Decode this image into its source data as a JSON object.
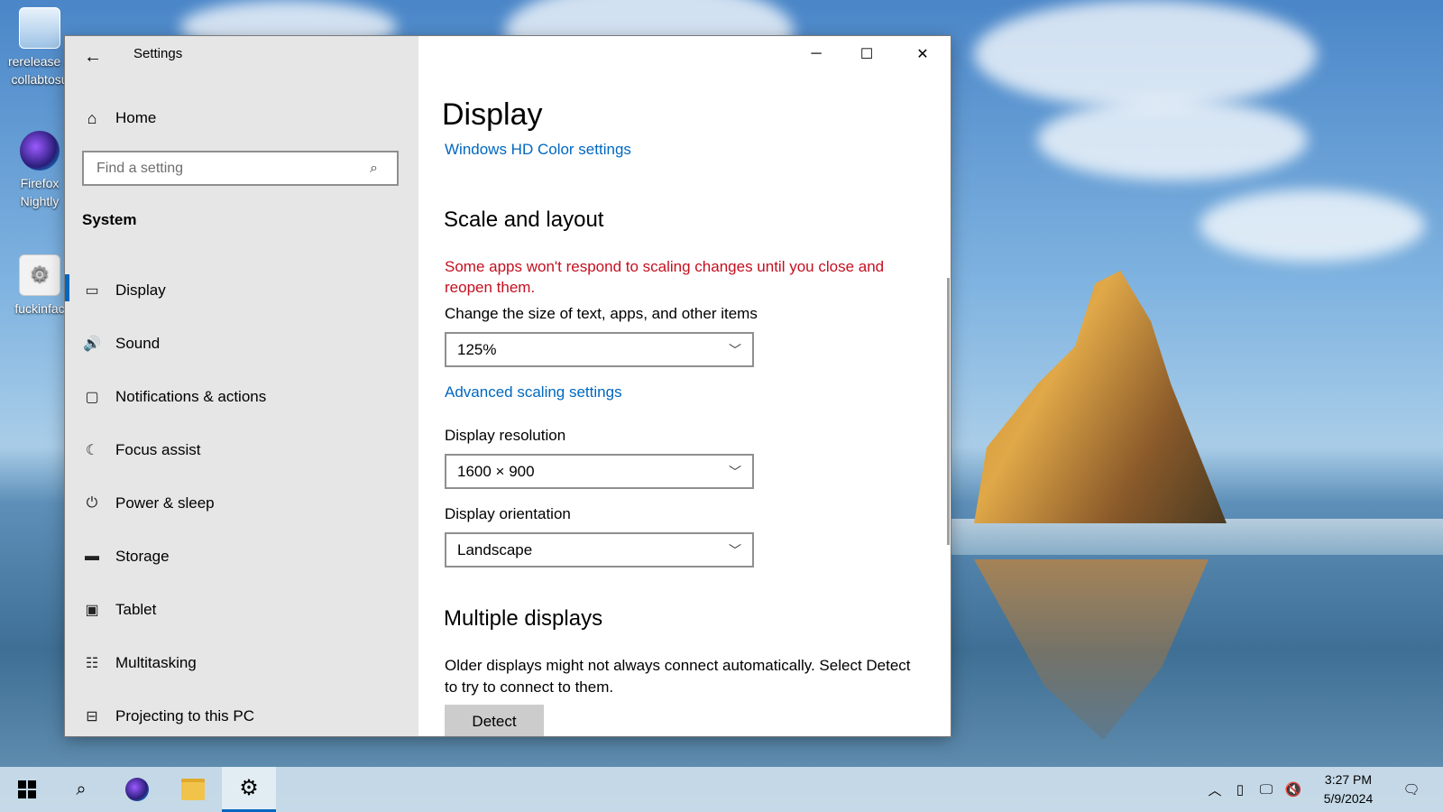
{
  "desktop": {
    "icons": [
      {
        "label_line1": "rerelease a",
        "label_line2": "collabtosu"
      },
      {
        "label_line1": "Firefox",
        "label_line2": "Nightly"
      },
      {
        "label_line1": "fuckinfac",
        "label_line2": ""
      }
    ]
  },
  "window": {
    "title": "Settings",
    "back_glyph": "←",
    "controls": {
      "minimize": "─",
      "maximize": "☐",
      "close": "✕"
    }
  },
  "sidebar": {
    "home_label": "Home",
    "search_placeholder": "Find a setting",
    "section": "System",
    "items": [
      {
        "label": "Display",
        "icon": "monitor-icon",
        "glyph": "▭",
        "active": true
      },
      {
        "label": "Sound",
        "icon": "speaker-icon",
        "glyph": "🔊"
      },
      {
        "label": "Notifications & actions",
        "icon": "notification-icon",
        "glyph": "▢"
      },
      {
        "label": "Focus assist",
        "icon": "moon-icon",
        "glyph": "☾"
      },
      {
        "label": "Power & sleep",
        "icon": "power-icon",
        "glyph": "⏻"
      },
      {
        "label": "Storage",
        "icon": "storage-icon",
        "glyph": "▬"
      },
      {
        "label": "Tablet",
        "icon": "tablet-icon",
        "glyph": "▣"
      },
      {
        "label": "Multitasking",
        "icon": "multitasking-icon",
        "glyph": "☷"
      },
      {
        "label": "Projecting to this PC",
        "icon": "projecting-icon",
        "glyph": "⊟"
      }
    ]
  },
  "main": {
    "title": "Display",
    "hd_color_link": "Windows HD Color settings",
    "scale_heading": "Scale and layout",
    "scale_warning": "Some apps won't respond to scaling changes until you close and reopen them.",
    "scale_label": "Change the size of text, apps, and other items",
    "scale_value": "125%",
    "advanced_scaling_link": "Advanced scaling settings",
    "resolution_label": "Display resolution",
    "resolution_value": "1600 × 900",
    "orientation_label": "Display orientation",
    "orientation_value": "Landscape",
    "multiple_heading": "Multiple displays",
    "multiple_text": "Older displays might not always connect automatically. Select Detect to try to connect to them.",
    "detect_button": "Detect"
  },
  "taskbar": {
    "time": "3:27 PM",
    "date": "5/9/2024",
    "accent": "#0067c0"
  },
  "colors": {
    "accent": "#0067c0",
    "warning": "#c50f1f",
    "sidebar_bg": "#e6e6e6"
  }
}
